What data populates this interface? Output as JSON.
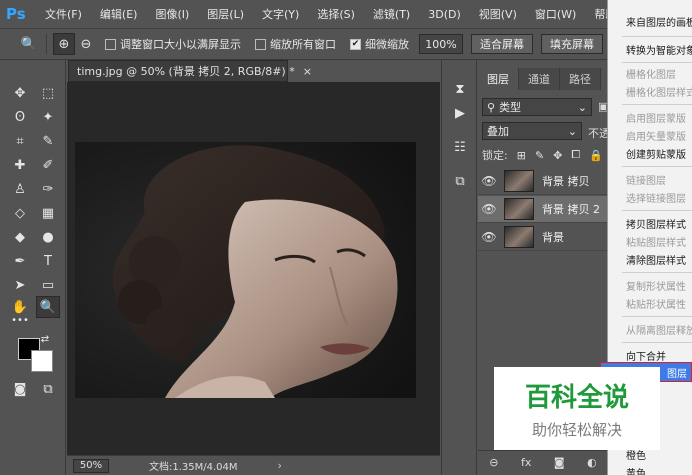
{
  "app": {
    "logo": "Ps"
  },
  "menubar": {
    "items": [
      "文件(F)",
      "编辑(E)",
      "图像(I)",
      "图层(L)",
      "文字(Y)",
      "选择(S)",
      "滤镜(T)",
      "3D(D)",
      "视图(V)",
      "窗口(W)",
      "帮助(H)"
    ]
  },
  "options": {
    "resize_windows": "调整窗口大小以满屏显示",
    "zoom_all": "缩放所有窗口",
    "scrubby_zoom": "细微缩放",
    "zoom_value": "100%",
    "fit_screen": "适合屏幕",
    "fill_screen": "填充屏幕"
  },
  "document": {
    "tab_title": "timg.jpg @ 50% (背景 拷贝 2, RGB/8#) *",
    "zoom": "50%",
    "doc_info": "文档:1.35M/4.04M"
  },
  "layers_panel": {
    "tabs": [
      "图层",
      "通道",
      "路径"
    ],
    "kind_filter": "类型",
    "blend_mode": "叠加",
    "opacity_label": "不透",
    "lock_label": "锁定:",
    "layers": [
      {
        "name": "背景 拷贝",
        "selected": false
      },
      {
        "name": "背景 拷贝 2",
        "selected": true
      },
      {
        "name": "背景",
        "selected": false
      }
    ],
    "footer_fx": "fx"
  },
  "context_menu": {
    "items": [
      {
        "label": "来自图层的画板",
        "enabled": true
      },
      {
        "label": "转换为智能对象",
        "enabled": true
      },
      {
        "label": "栅格化图层",
        "enabled": false
      },
      {
        "label": "栅格化图层样式",
        "enabled": false
      },
      {
        "label": "启用图层蒙版",
        "enabled": false
      },
      {
        "label": "启用矢量蒙版",
        "enabled": false
      },
      {
        "label": "创建剪贴蒙版",
        "enabled": true
      },
      {
        "label": "链接图层",
        "enabled": false
      },
      {
        "label": "选择链接图层",
        "enabled": false
      },
      {
        "label": "拷贝图层样式",
        "enabled": true
      },
      {
        "label": "粘贴图层样式",
        "enabled": false
      },
      {
        "label": "清除图层样式",
        "enabled": true
      },
      {
        "label": "复制形状属性",
        "enabled": false
      },
      {
        "label": "粘贴形状属性",
        "enabled": false
      },
      {
        "label": "从隔离图层释放",
        "enabled": false
      },
      {
        "label": "向下合并",
        "enabled": true
      },
      {
        "label": "橙色",
        "enabled": true
      },
      {
        "label": "黄色",
        "enabled": true
      }
    ],
    "highlighted": "图层"
  },
  "watermark": {
    "title": "百科全说",
    "subtitle": "助你轻松解决"
  },
  "colors": {
    "accent": "#3d7be6",
    "watermark_green": "#1f9a3b",
    "ps_blue": "#31a8ff"
  }
}
